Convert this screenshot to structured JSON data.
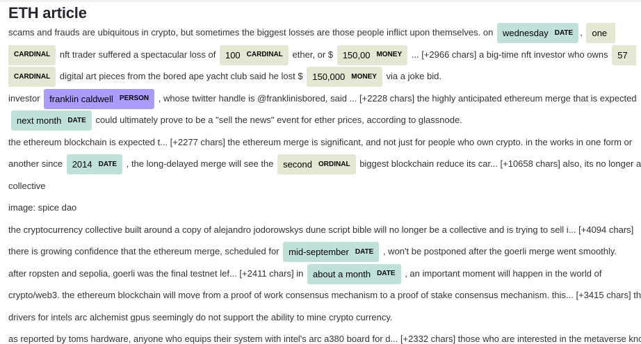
{
  "title": "ETH article",
  "labels": {
    "date": "DATE",
    "cardinal": "CARDINAL",
    "money": "MONEY",
    "person": "PERSON",
    "ordinal": "ORDINAL"
  },
  "entities": {
    "wednesday": "wednesday",
    "one": "one",
    "hundred": "100",
    "money150": "150,00",
    "fiftyseven": "57",
    "money150000": "150,000",
    "franklin": "franklin caldwell",
    "nextmonth": "next month",
    "year2014": "2014",
    "second": "second",
    "midsept": "mid-september",
    "aboutmonth": "about a month"
  },
  "text": {
    "l1a": "scams and frauds are ubiquitous in crypto, but sometimes the biggest losses are those people inflict upon themselves. on",
    "l1b": ",",
    "l2a": "nft trader suffered a spectacular loss of",
    "l2b": "ether, or $",
    "l2c": "... [+2966 chars] a big-time nft investor who owns",
    "l3a": "digital art pieces from the bored ape yacht club said he lost $",
    "l3b": "via a joke bid.",
    "l4a": "investor",
    "l4b": ", whose twitter handle is @franklinisbored, said ... [+2228 chars] the highly anticipated ethereum merge that is expected",
    "l5a": "could ultimately prove to be a \"sell the news\" event for ether prices, according to glassnode.",
    "l6": "the ethereum blockchain is expected t... [+2277 chars] the ethereum merge is significant, and not just for people who own crypto. in the works in one form or",
    "l7a": "another since",
    "l7b": ", the long-delayed merge will see the",
    "l7c": "biggest blockchain reduce its car... [+10658 chars] also, its no longer a",
    "l8": "collective",
    "l9": "image: spice dao",
    "l10": "the cryptocurrency collective built around a copy of alejandro jodorowskys dune script bible will no longer be a collective and is trying to sell i... [+4094 chars]",
    "l11a": "there is growing confidence that the ethereum merge, scheduled for",
    "l11b": ", won't be postponed after the goerli merge went smoothly.",
    "l12a": "after ropsten and sepolia, goerli was the final testnet lef... [+2411 chars] in",
    "l12b": ", an important moment will happen in the world of",
    "l13": "crypto/web3. the ethereum blockchain will move from a proof of work consensus mechanism to a proof of stake consensus mechanism. this... [+3415 chars] the",
    "l14": "drivers for intels arc alchemist gpus seemingly do not support the ability to mine crypto currency.",
    "l15": "as reported by toms hardware, anyone who equips their system with intel's arc a380 board for d... [+2332 chars] those who are interested in the metaverse know"
  }
}
